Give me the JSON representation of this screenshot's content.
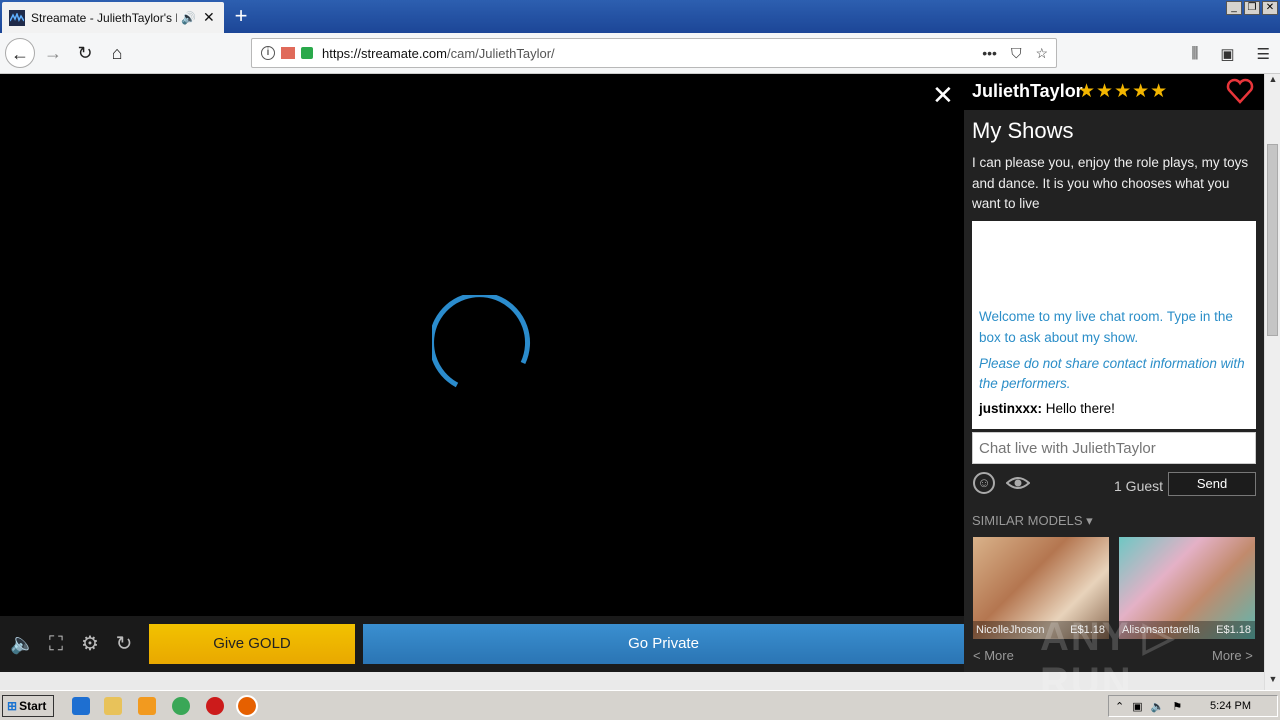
{
  "browser": {
    "tab_title": "Streamate - JuliethTaylor's Pro",
    "tab_close": "✕",
    "new_tab": "+",
    "url_host": "https://streamate.com",
    "url_path": "/cam/JuliethTaylor/",
    "url_actions": [
      "•••",
      "⛉",
      "☆"
    ]
  },
  "video": {
    "close": "✕"
  },
  "controls": {
    "give_gold": "Give GOLD",
    "go_private": "Go Private"
  },
  "panel": {
    "performer_name": "JuliethTaylor",
    "stars": "★★★★★",
    "section_title": "My Shows",
    "description": "I can please you, enjoy the role plays, my toys and dance. It is you who chooses what you want to live",
    "chat": {
      "welcome": "Welcome to my live chat room. Type in the box to ask about my show.",
      "warning": "Please do not share contact information with the performers.",
      "messages": [
        {
          "user": "justinxxx:",
          "text": "Hello there!"
        }
      ],
      "input_placeholder": "Chat live with JuliethTaylor",
      "guests": "1 Guest",
      "send": "Send"
    },
    "similar_title": "SIMILAR MODELS",
    "similar_models": [
      {
        "name": "NicolleJhoson",
        "tag": "E$1.18"
      },
      {
        "name": "Alisonsantarella",
        "tag": "E$1.18"
      }
    ],
    "prev_more": "< More",
    "next_more": "More >"
  },
  "watermark": "ANY ▷ RUN",
  "taskbar": {
    "start": "Start",
    "time": "5:24 PM"
  }
}
